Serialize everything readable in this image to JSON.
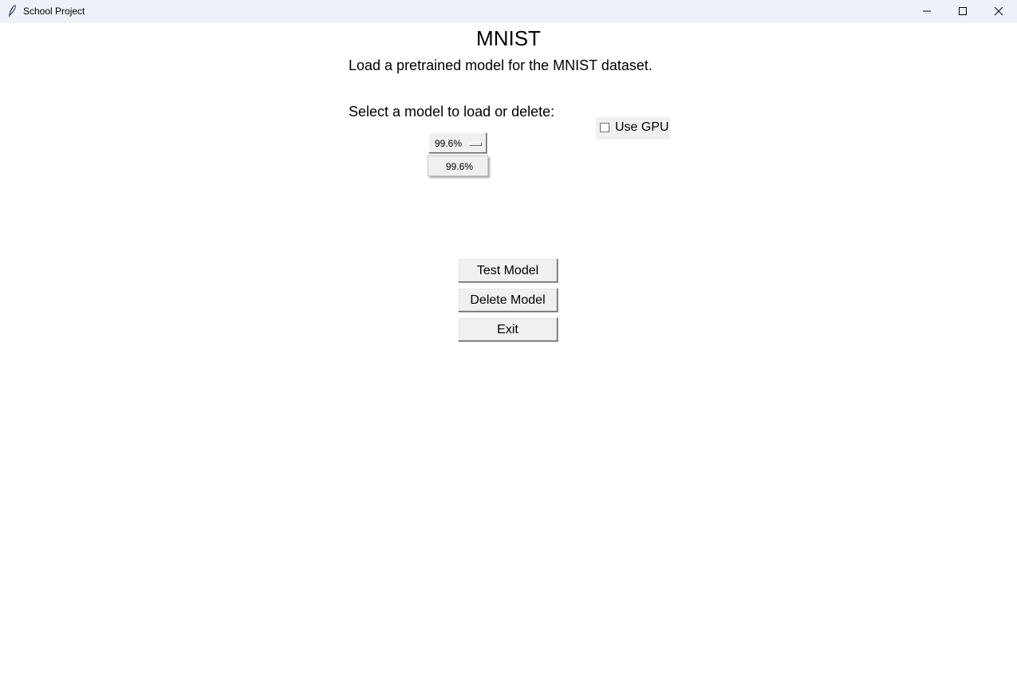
{
  "window": {
    "title": "School Project",
    "icon": "feather-icon",
    "controls": [
      "minimize-icon",
      "maximize-icon",
      "close-icon"
    ]
  },
  "main": {
    "title": "MNIST",
    "subtitle": "Load a pretrained model for the MNIST dataset.",
    "select_label": "Select a model to load or delete:",
    "model_select": {
      "selected": "99.6%",
      "options": [
        "99.6%"
      ]
    },
    "use_gpu": {
      "label": "Use GPU",
      "checked": false
    },
    "buttons": {
      "test": "Test Model",
      "delete": "Delete Model",
      "exit": "Exit"
    }
  }
}
